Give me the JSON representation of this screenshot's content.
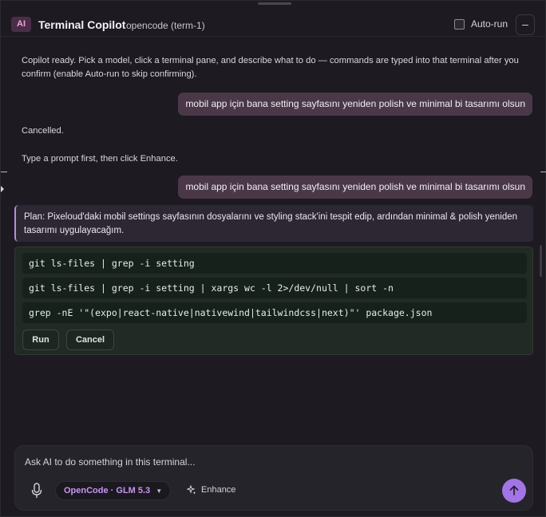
{
  "header": {
    "badge": "AI",
    "title": "Terminal Copilot",
    "subtitle": "opencode (term-1)",
    "autorun_label": "Auto-run",
    "autorun_checked": false,
    "collapse_label": "–"
  },
  "messages": {
    "intro": "Copilot ready. Pick a model, click a terminal pane, and describe what to do — commands are typed into that terminal after you confirm (enable Auto-run to skip confirming).",
    "user_1": "mobil app için bana setting sayfasını yeniden polish ve minimal bi tasarımı olsun",
    "cancelled": "Cancelled.",
    "hint": "Type a prompt first, then click Enhance.",
    "user_2": "mobil app için bana setting sayfasını yeniden polish ve minimal bi tasarımı olsun",
    "plan": "Plan: Pixeloud'daki mobil settings sayfasının dosyalarını ve styling stack'ini tespit edip, ardından minimal & polish yeniden tasarımı uygulayacağım."
  },
  "commands": [
    "git ls-files | grep -i setting",
    "git ls-files | grep -i setting | xargs wc -l 2>/dev/null | sort -n",
    "grep -nE '\"(expo|react-native|nativewind|tailwindcss|next)\"' package.json"
  ],
  "command_actions": {
    "run_label": "Run",
    "cancel_label": "Cancel"
  },
  "composer": {
    "placeholder": "Ask AI to do something in this terminal...",
    "model_label": "OpenCode · GLM 5.3",
    "enhance_label": "Enhance"
  },
  "icons": {
    "mic": "microphone-icon",
    "chevron": "chevron-down-icon",
    "enhance": "sparkle-icon",
    "send": "arrow-up-icon"
  },
  "colors": {
    "accent": "#a175e5",
    "model_text": "#c596f4",
    "user_bubble": "#4a3848",
    "plan_border": "#b68ed8",
    "command_bg": "#17211b"
  }
}
